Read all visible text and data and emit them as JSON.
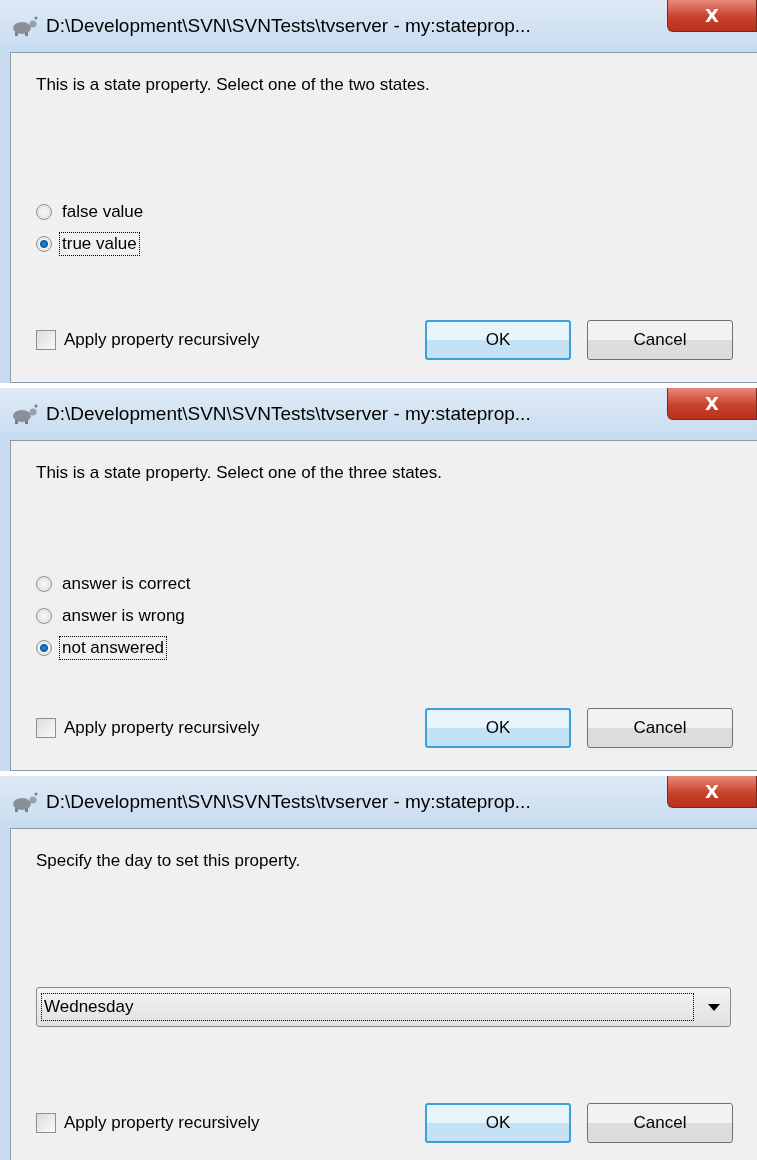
{
  "dialogs": [
    {
      "title": "D:\\Development\\SVN\\SVNTests\\tvserver - my:stateprop...",
      "close": "X",
      "prompt": "This is a state property. Select one of the two states.",
      "kind": "radio",
      "options": [
        {
          "label": "false value",
          "selected": false
        },
        {
          "label": "true value",
          "selected": true
        }
      ],
      "recursive": {
        "label": "Apply property recursively",
        "checked": false
      },
      "buttons": [
        {
          "label": "OK",
          "default": true
        },
        {
          "label": "Cancel",
          "default": false
        }
      ]
    },
    {
      "title": "D:\\Development\\SVN\\SVNTests\\tvserver - my:stateprop...",
      "close": "X",
      "prompt": "This is a state property. Select one of the three states.",
      "kind": "radio",
      "options": [
        {
          "label": "answer is correct",
          "selected": false
        },
        {
          "label": "answer is wrong",
          "selected": false
        },
        {
          "label": "not answered",
          "selected": true
        }
      ],
      "recursive": {
        "label": "Apply property recursively",
        "checked": false
      },
      "buttons": [
        {
          "label": "OK",
          "default": true
        },
        {
          "label": "Cancel",
          "default": false
        }
      ]
    },
    {
      "title": "D:\\Development\\SVN\\SVNTests\\tvserver - my:stateprop...",
      "close": "X",
      "prompt": "Specify the day to set this property.",
      "kind": "dropdown",
      "value": "Wednesday",
      "recursive": {
        "label": "Apply property recursively",
        "checked": false
      },
      "buttons": [
        {
          "label": "OK",
          "default": true
        },
        {
          "label": "Cancel",
          "default": false
        }
      ]
    }
  ]
}
